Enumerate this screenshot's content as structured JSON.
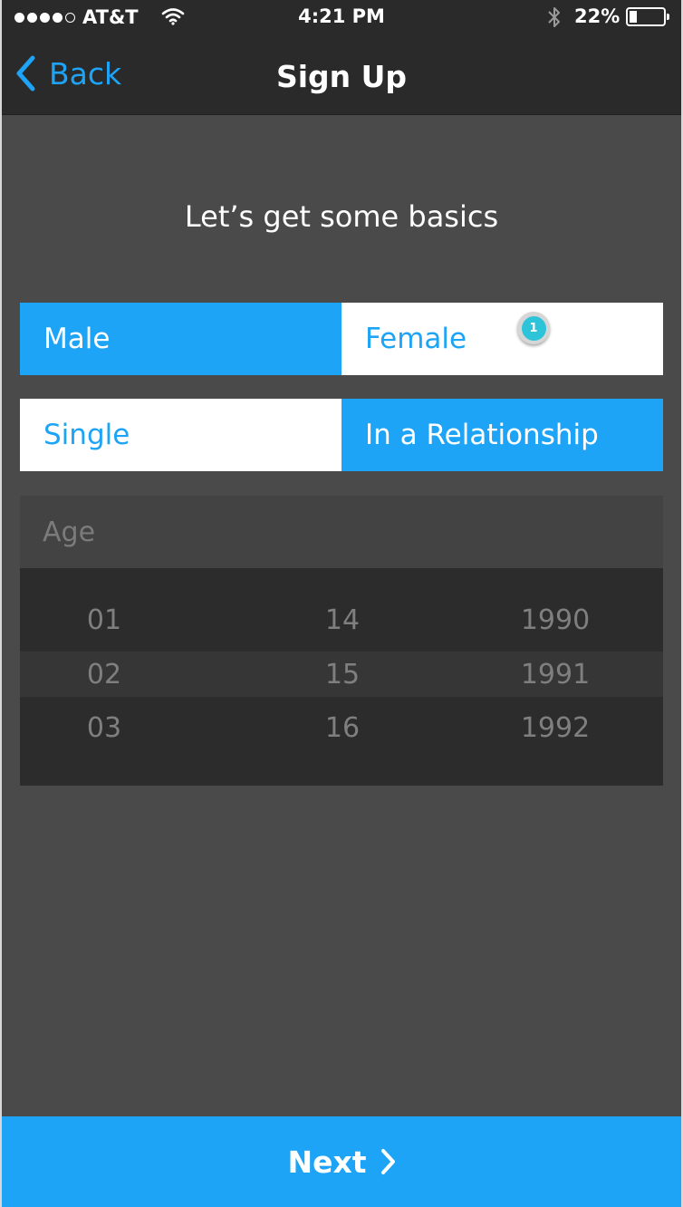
{
  "status_bar": {
    "carrier": "AT&T",
    "time": "4:21 PM",
    "battery_percent": "22%",
    "battery_level": 0.22,
    "signal_bars_filled": 4,
    "signal_bars_total": 5
  },
  "nav": {
    "back_label": "Back",
    "title": "Sign Up"
  },
  "heading": "Let’s get some basics",
  "gender": {
    "options": [
      "Male",
      "Female"
    ],
    "selected": "Male",
    "badge": "1"
  },
  "relationship": {
    "options": [
      "Single",
      "In a Relationship"
    ],
    "selected": "In a Relationship"
  },
  "age": {
    "label": "Age",
    "columns": {
      "month": [
        "01",
        "02",
        "03"
      ],
      "day": [
        "14",
        "15",
        "16"
      ],
      "year": [
        "1990",
        "1991",
        "1992"
      ]
    }
  },
  "next_label": "Next",
  "colors": {
    "accent": "#1ea4f7",
    "background": "#4a4a4a",
    "bar": "#2a2a2a",
    "badge": "#2dc3d8"
  },
  "icons": [
    "signal-icon",
    "wifi-icon",
    "bluetooth-icon",
    "battery-icon",
    "back-chevron-icon",
    "next-chevron-icon"
  ]
}
